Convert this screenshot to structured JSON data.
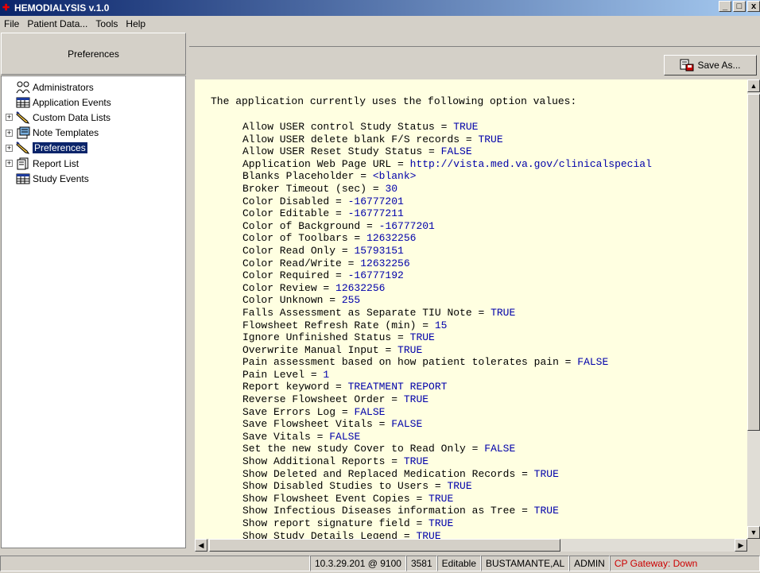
{
  "window": {
    "title": "HEMODIALYSIS  v.1.0",
    "minimize": "_",
    "maximize": "□",
    "close": "x"
  },
  "menu": [
    "File",
    "Patient Data...",
    "Tools",
    "Help"
  ],
  "left_panel": {
    "header": "Preferences",
    "tree": [
      {
        "label": "Administrators",
        "expandable": false,
        "selected": false,
        "icon": "people-icon"
      },
      {
        "label": "Application Events",
        "expandable": false,
        "selected": false,
        "icon": "grid-icon"
      },
      {
        "label": "Custom Data Lists",
        "expandable": true,
        "selected": false,
        "icon": "pencil-icon"
      },
      {
        "label": "Note Templates",
        "expandable": true,
        "selected": false,
        "icon": "note-icon"
      },
      {
        "label": "Preferences",
        "expandable": true,
        "selected": true,
        "icon": "pencil-icon"
      },
      {
        "label": "Report List",
        "expandable": true,
        "selected": false,
        "icon": "report-icon"
      },
      {
        "label": "Study Events",
        "expandable": false,
        "selected": false,
        "icon": "grid-icon"
      }
    ]
  },
  "toolbar": {
    "save_as": "Save As..."
  },
  "memo": {
    "intro": "The application currently uses the following option values:",
    "options": [
      {
        "key": "Allow USER control Study Status",
        "value": "TRUE"
      },
      {
        "key": "Allow USER delete blank F/S records",
        "value": "TRUE"
      },
      {
        "key": "Allow USER Reset Study Status",
        "value": "FALSE"
      },
      {
        "key": "Application Web Page URL",
        "value": "http://vista.med.va.gov/clinicalspecial"
      },
      {
        "key": "Blanks Placeholder",
        "value": "<blank>"
      },
      {
        "key": "Broker Timeout (sec)",
        "value": "30"
      },
      {
        "key": "Color Disabled",
        "value": "-16777201"
      },
      {
        "key": "Color Editable",
        "value": "-16777211"
      },
      {
        "key": "Color of Background",
        "value": "-16777201"
      },
      {
        "key": "Color of Toolbars",
        "value": "12632256"
      },
      {
        "key": "Color Read Only",
        "value": "15793151"
      },
      {
        "key": "Color Read/Write",
        "value": "12632256"
      },
      {
        "key": "Color Required",
        "value": "-16777192"
      },
      {
        "key": "Color Review",
        "value": "12632256"
      },
      {
        "key": "Color Unknown",
        "value": "255"
      },
      {
        "key": "Falls Assessment as Separate TIU Note",
        "value": "TRUE"
      },
      {
        "key": "Flowsheet Refresh Rate (min)",
        "value": "15"
      },
      {
        "key": "Ignore Unfinished Status",
        "value": "TRUE"
      },
      {
        "key": "Overwrite Manual Input",
        "value": "TRUE"
      },
      {
        "key": "Pain assessment based on how patient tolerates pain",
        "value": "FALSE"
      },
      {
        "key": "Pain Level",
        "value": "1"
      },
      {
        "key": "Report keyword",
        "value": "TREATMENT REPORT"
      },
      {
        "key": "Reverse Flowsheet Order",
        "value": "TRUE"
      },
      {
        "key": "Save Errors Log",
        "value": "FALSE"
      },
      {
        "key": "Save Flowsheet Vitals",
        "value": "FALSE"
      },
      {
        "key": "Save Vitals",
        "value": "FALSE"
      },
      {
        "key": "Set the new study Cover to Read Only",
        "value": "FALSE"
      },
      {
        "key": "Show Additional Reports",
        "value": "TRUE"
      },
      {
        "key": "Show Deleted and Replaced Medication Records",
        "value": "TRUE"
      },
      {
        "key": "Show Disabled Studies to Users",
        "value": "TRUE"
      },
      {
        "key": "Show Flowsheet Event Copies",
        "value": "TRUE"
      },
      {
        "key": "Show Infectious Diseases information as Tree",
        "value": "TRUE"
      },
      {
        "key": "Show report signature field",
        "value": "TRUE"
      },
      {
        "key": "Show Study Details Legend",
        "value": "TRUE"
      }
    ]
  },
  "status": {
    "server": "10.3.29.201 @ 9100",
    "count": "3581",
    "mode": "Editable",
    "user": "BUSTAMANTE,AL",
    "role": "ADMIN",
    "gateway": "CP Gateway: Down",
    "gateway_color": "#cc0000"
  }
}
